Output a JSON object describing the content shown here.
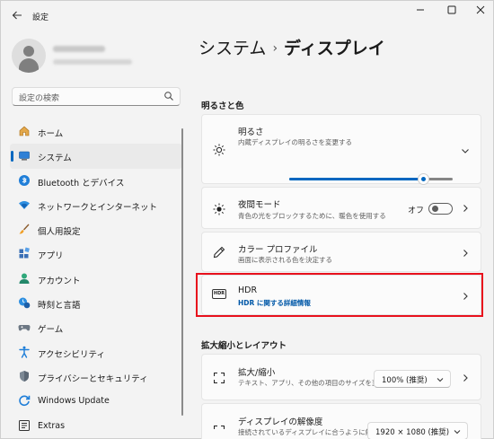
{
  "window": {
    "title": "設定"
  },
  "sidebar": {
    "search_placeholder": "設定の検索",
    "items": [
      {
        "label": "ホーム",
        "icon": "home-icon"
      },
      {
        "label": "システム",
        "icon": "system-icon",
        "selected": true
      },
      {
        "label": "Bluetooth とデバイス",
        "icon": "bluetooth-icon"
      },
      {
        "label": "ネットワークとインターネット",
        "icon": "wifi-icon"
      },
      {
        "label": "個人用設定",
        "icon": "brush-icon"
      },
      {
        "label": "アプリ",
        "icon": "apps-icon"
      },
      {
        "label": "アカウント",
        "icon": "account-icon"
      },
      {
        "label": "時刻と言語",
        "icon": "time-language-icon"
      },
      {
        "label": "ゲーム",
        "icon": "gamepad-icon"
      },
      {
        "label": "アクセシビリティ",
        "icon": "accessibility-icon"
      },
      {
        "label": "プライバシーとセキュリティ",
        "icon": "shield-icon"
      },
      {
        "label": "Windows Update",
        "icon": "windows-update-icon"
      },
      {
        "label": "Extras",
        "icon": "extras-icon"
      }
    ]
  },
  "header": {
    "breadcrumb_parent": "システム",
    "separator": "›",
    "breadcrumb_current": "ディスプレイ"
  },
  "sections": {
    "brightness_color": "明るさと色",
    "scale_layout": "拡大縮小とレイアウト"
  },
  "brightness": {
    "title": "明るさ",
    "subtitle": "内蔵ディスプレイの明るさを変更する",
    "level_percent": 82
  },
  "night_light": {
    "title": "夜間モード",
    "subtitle": "青色の光をブロックするために、暖色を使用する",
    "state_label": "オフ"
  },
  "color_profile": {
    "title": "カラー プロファイル",
    "subtitle": "画面に表示される色を決定する"
  },
  "hdr": {
    "badge": "HDR",
    "title": "HDR",
    "link": "HDR に関する詳細情報"
  },
  "scale": {
    "title": "拡大/縮小",
    "subtitle": "テキスト、アプリ、その他の項目のサイズを変更する",
    "value": "100% (推奨)"
  },
  "resolution": {
    "title": "ディスプレイの解像度",
    "subtitle": "接続されているディスプレイに合うように解像度を",
    "value": "1920 × 1080 (推奨)"
  },
  "colors": {
    "accent": "#0067c0",
    "highlight": "#e8101c"
  }
}
